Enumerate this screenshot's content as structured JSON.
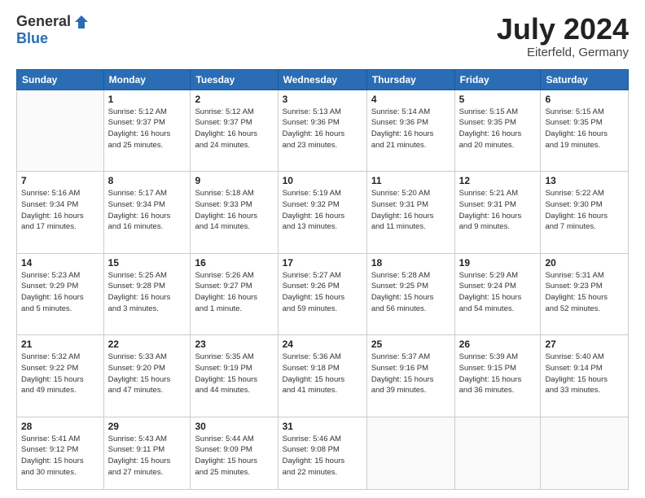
{
  "logo": {
    "general": "General",
    "blue": "Blue"
  },
  "title": "July 2024",
  "subtitle": "Eiterfeld, Germany",
  "days_header": [
    "Sunday",
    "Monday",
    "Tuesday",
    "Wednesday",
    "Thursday",
    "Friday",
    "Saturday"
  ],
  "weeks": [
    [
      {
        "day": "",
        "info": ""
      },
      {
        "day": "1",
        "info": "Sunrise: 5:12 AM\nSunset: 9:37 PM\nDaylight: 16 hours\nand 25 minutes."
      },
      {
        "day": "2",
        "info": "Sunrise: 5:12 AM\nSunset: 9:37 PM\nDaylight: 16 hours\nand 24 minutes."
      },
      {
        "day": "3",
        "info": "Sunrise: 5:13 AM\nSunset: 9:36 PM\nDaylight: 16 hours\nand 23 minutes."
      },
      {
        "day": "4",
        "info": "Sunrise: 5:14 AM\nSunset: 9:36 PM\nDaylight: 16 hours\nand 21 minutes."
      },
      {
        "day": "5",
        "info": "Sunrise: 5:15 AM\nSunset: 9:35 PM\nDaylight: 16 hours\nand 20 minutes."
      },
      {
        "day": "6",
        "info": "Sunrise: 5:15 AM\nSunset: 9:35 PM\nDaylight: 16 hours\nand 19 minutes."
      }
    ],
    [
      {
        "day": "7",
        "info": "Sunrise: 5:16 AM\nSunset: 9:34 PM\nDaylight: 16 hours\nand 17 minutes."
      },
      {
        "day": "8",
        "info": "Sunrise: 5:17 AM\nSunset: 9:34 PM\nDaylight: 16 hours\nand 16 minutes."
      },
      {
        "day": "9",
        "info": "Sunrise: 5:18 AM\nSunset: 9:33 PM\nDaylight: 16 hours\nand 14 minutes."
      },
      {
        "day": "10",
        "info": "Sunrise: 5:19 AM\nSunset: 9:32 PM\nDaylight: 16 hours\nand 13 minutes."
      },
      {
        "day": "11",
        "info": "Sunrise: 5:20 AM\nSunset: 9:31 PM\nDaylight: 16 hours\nand 11 minutes."
      },
      {
        "day": "12",
        "info": "Sunrise: 5:21 AM\nSunset: 9:31 PM\nDaylight: 16 hours\nand 9 minutes."
      },
      {
        "day": "13",
        "info": "Sunrise: 5:22 AM\nSunset: 9:30 PM\nDaylight: 16 hours\nand 7 minutes."
      }
    ],
    [
      {
        "day": "14",
        "info": "Sunrise: 5:23 AM\nSunset: 9:29 PM\nDaylight: 16 hours\nand 5 minutes."
      },
      {
        "day": "15",
        "info": "Sunrise: 5:25 AM\nSunset: 9:28 PM\nDaylight: 16 hours\nand 3 minutes."
      },
      {
        "day": "16",
        "info": "Sunrise: 5:26 AM\nSunset: 9:27 PM\nDaylight: 16 hours\nand 1 minute."
      },
      {
        "day": "17",
        "info": "Sunrise: 5:27 AM\nSunset: 9:26 PM\nDaylight: 15 hours\nand 59 minutes."
      },
      {
        "day": "18",
        "info": "Sunrise: 5:28 AM\nSunset: 9:25 PM\nDaylight: 15 hours\nand 56 minutes."
      },
      {
        "day": "19",
        "info": "Sunrise: 5:29 AM\nSunset: 9:24 PM\nDaylight: 15 hours\nand 54 minutes."
      },
      {
        "day": "20",
        "info": "Sunrise: 5:31 AM\nSunset: 9:23 PM\nDaylight: 15 hours\nand 52 minutes."
      }
    ],
    [
      {
        "day": "21",
        "info": "Sunrise: 5:32 AM\nSunset: 9:22 PM\nDaylight: 15 hours\nand 49 minutes."
      },
      {
        "day": "22",
        "info": "Sunrise: 5:33 AM\nSunset: 9:20 PM\nDaylight: 15 hours\nand 47 minutes."
      },
      {
        "day": "23",
        "info": "Sunrise: 5:35 AM\nSunset: 9:19 PM\nDaylight: 15 hours\nand 44 minutes."
      },
      {
        "day": "24",
        "info": "Sunrise: 5:36 AM\nSunset: 9:18 PM\nDaylight: 15 hours\nand 41 minutes."
      },
      {
        "day": "25",
        "info": "Sunrise: 5:37 AM\nSunset: 9:16 PM\nDaylight: 15 hours\nand 39 minutes."
      },
      {
        "day": "26",
        "info": "Sunrise: 5:39 AM\nSunset: 9:15 PM\nDaylight: 15 hours\nand 36 minutes."
      },
      {
        "day": "27",
        "info": "Sunrise: 5:40 AM\nSunset: 9:14 PM\nDaylight: 15 hours\nand 33 minutes."
      }
    ],
    [
      {
        "day": "28",
        "info": "Sunrise: 5:41 AM\nSunset: 9:12 PM\nDaylight: 15 hours\nand 30 minutes."
      },
      {
        "day": "29",
        "info": "Sunrise: 5:43 AM\nSunset: 9:11 PM\nDaylight: 15 hours\nand 27 minutes."
      },
      {
        "day": "30",
        "info": "Sunrise: 5:44 AM\nSunset: 9:09 PM\nDaylight: 15 hours\nand 25 minutes."
      },
      {
        "day": "31",
        "info": "Sunrise: 5:46 AM\nSunset: 9:08 PM\nDaylight: 15 hours\nand 22 minutes."
      },
      {
        "day": "",
        "info": ""
      },
      {
        "day": "",
        "info": ""
      },
      {
        "day": "",
        "info": ""
      }
    ]
  ]
}
